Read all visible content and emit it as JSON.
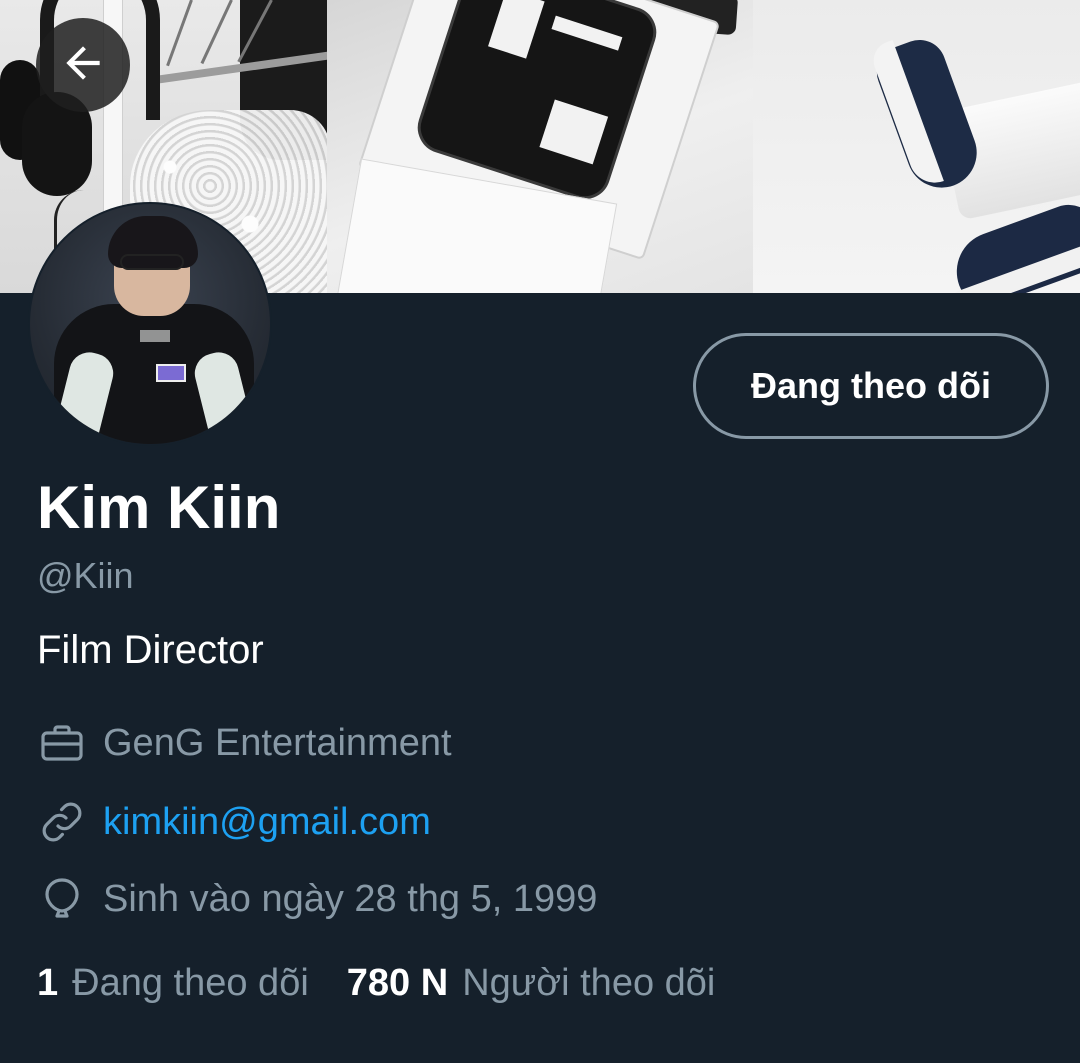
{
  "profile": {
    "display_name": "Kim Kiin",
    "handle": "@Kiin",
    "bio": "Film Director",
    "work": "GenG Entertainment",
    "link": "kimkiin@gmail.com",
    "birth": "Sinh vào ngày 28 thg 5, 1999"
  },
  "actions": {
    "follow_label": "Đang theo dõi"
  },
  "stats": {
    "following_count": "1",
    "following_label": "Đang theo dõi",
    "followers_count": "780 N",
    "followers_label": "Người theo dõi"
  },
  "icons": {
    "back": "arrow-left-icon",
    "work": "briefcase-icon",
    "link": "link-icon",
    "birth": "balloon-icon"
  },
  "colors": {
    "background": "#15202b",
    "muted_text": "#8899a6",
    "link": "#1da1f2",
    "primary_text": "#ffffff"
  }
}
